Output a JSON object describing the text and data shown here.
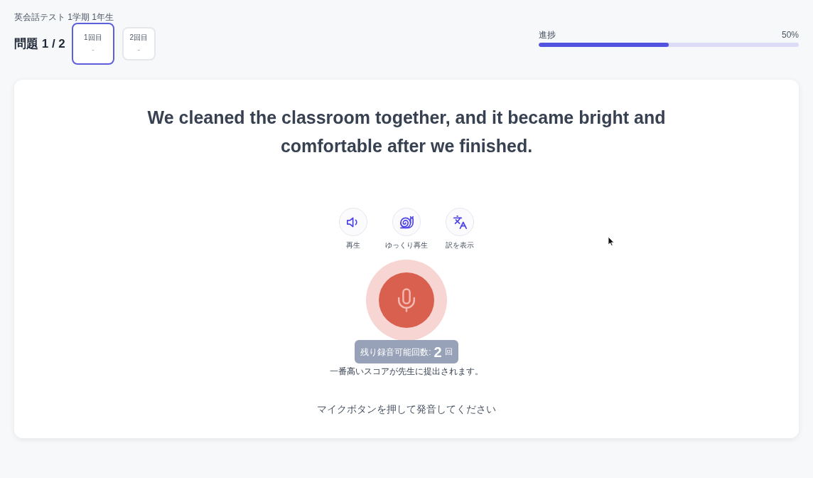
{
  "header": {
    "test_title": "英会話テスト 1学期 1年生",
    "question_counter": "問題 1 / 2"
  },
  "attempts": [
    {
      "label": "1回目",
      "score": "-",
      "selected": true
    },
    {
      "label": "2回目",
      "score": "-",
      "selected": false
    }
  ],
  "progress": {
    "label": "進捗",
    "reading": "50%",
    "level": 0.5
  },
  "card": {
    "sentence": "We cleaned the classroom together, and it became bright and comfortable after we finished.",
    "actions": [
      {
        "kind": "play",
        "label": "再生"
      },
      {
        "kind": "slow",
        "label": "ゆっくり再生"
      },
      {
        "kind": "translate",
        "label": "訳を表示"
      }
    ],
    "remaining": {
      "label": "残り録音可能回数:",
      "count": "2",
      "unit": "回"
    },
    "note": "一番高いスコアが先生に提出されます。",
    "instruction": "マイクボタンを押して発音してください"
  }
}
